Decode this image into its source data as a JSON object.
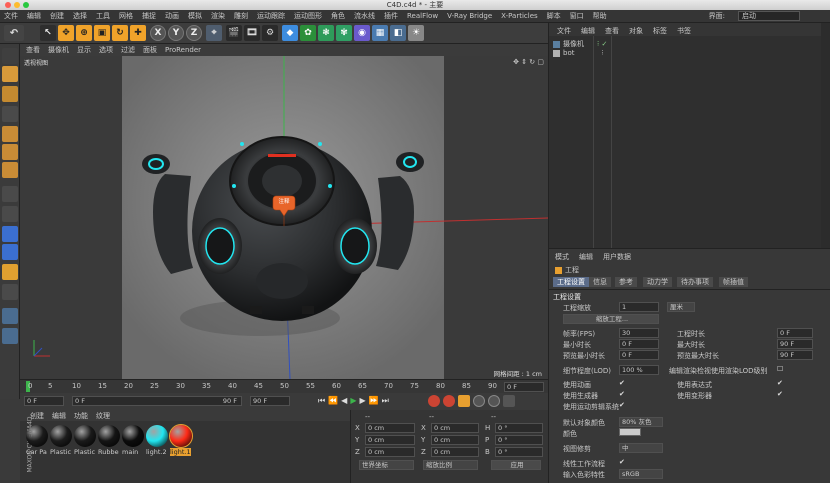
{
  "title": "C4D.c4d * - 主要",
  "menus": [
    "文件",
    "编辑",
    "创建",
    "选择",
    "工具",
    "网格",
    "捕捉",
    "动画",
    "模拟",
    "渲染",
    "雕刻",
    "运动跟踪",
    "运动图形",
    "角色",
    "流水线",
    "插件",
    "RealFlow",
    "V-Ray Bridge",
    "X-Particles",
    "脚本",
    "窗口",
    "帮助"
  ],
  "layout": {
    "label": "界面:",
    "value": "启动"
  },
  "toolbar": {
    "x": "X",
    "y": "Y",
    "z": "Z"
  },
  "viewport": {
    "menu": [
      "查看",
      "摄像机",
      "显示",
      "选项",
      "过滤",
      "面板",
      "ProRender"
    ],
    "title": "透视视图",
    "grid_label": "网格间距 : 1 cm",
    "tag_label": "注释"
  },
  "timeline": {
    "ticks": [
      "0",
      "5",
      "10",
      "15",
      "20",
      "25",
      "30",
      "35",
      "40",
      "45",
      "50",
      "55",
      "60",
      "65",
      "70",
      "75",
      "80",
      "85",
      "90"
    ],
    "current": "0 F"
  },
  "transport": {
    "start": "0 F",
    "start2": "0 F",
    "end": "90 F",
    "end2": "90 F"
  },
  "materials": {
    "menu": [
      "创建",
      "编辑",
      "功能",
      "纹理"
    ],
    "items": [
      {
        "name": "Car Pa",
        "color": "#1b1b1b"
      },
      {
        "name": "Plastic",
        "color": "#1c1c1c"
      },
      {
        "name": "Plastic",
        "color": "#1a1a1a"
      },
      {
        "name": "Rubbe",
        "color": "#151515"
      },
      {
        "name": "main",
        "color": "#0d0d0d"
      },
      {
        "name": "light.2",
        "color": "#22e6f0"
      },
      {
        "name": "light.1",
        "color": "#ff2a16"
      }
    ]
  },
  "brand": "MAXON CINEMA4D",
  "coords": {
    "header1": "--",
    "header2": "--",
    "header3": "--",
    "rows": [
      {
        "axis": "X",
        "pos": "0 cm",
        "axis2": "X",
        "rot": "0 cm",
        "axis3": "H",
        "ang": "0 °"
      },
      {
        "axis": "Y",
        "pos": "0 cm",
        "axis2": "Y",
        "rot": "0 cm",
        "axis3": "P",
        "ang": "0 °"
      },
      {
        "axis": "Z",
        "pos": "0 cm",
        "axis2": "Z",
        "rot": "0 cm",
        "axis3": "B",
        "ang": "0 °"
      }
    ],
    "mode1": "世界坐标",
    "mode2": "缩放比例",
    "apply": "应用"
  },
  "objects": {
    "menu": [
      "文件",
      "编辑",
      "查看",
      "对象",
      "标签",
      "书签"
    ],
    "items": [
      "摄像机",
      "bot"
    ]
  },
  "attributes": {
    "menu": [
      "模式",
      "编辑",
      "用户数据"
    ],
    "section": "工程",
    "tabs": [
      "工程设置",
      "信息",
      "参考",
      "动力学",
      "待办事项",
      "帧插值"
    ],
    "heading": "工程设置",
    "scale_label": "工程缩放",
    "scale_value": "1",
    "scale_unit": "厘米",
    "scale_button": "缩放工程...",
    "fps_label": "帧率(FPS)",
    "fps_value": "30",
    "proj_time_label": "工程时长",
    "proj_time_value": "0 F",
    "min_time_label": "最小时长",
    "min_time_value": "0 F",
    "max_time_label": "最大时长",
    "max_time_value": "90 F",
    "prev_min_label": "预览最小时长",
    "prev_min_value": "0 F",
    "prev_max_label": "预览最大时长",
    "prev_max_value": "90 F",
    "lod_label": "细节程度(LOD)",
    "lod_value": "100 %",
    "lod_render_label": "编辑渲染检视使用渲染LOD级别",
    "anim_label": "使用动画",
    "expr_label": "使用表达式",
    "gen_label": "使用生成器",
    "deform_label": "使用变形器",
    "motion_label": "使用运动剪辑系统",
    "default_color_label": "默认对象颜色",
    "default_color_value": "80% 灰色",
    "color_label": "颜色",
    "view_clip_label": "视图修剪",
    "view_clip_value": "中",
    "linear_label": "线性工作流程",
    "input_color_label": "输入色彩特性",
    "input_color_value": "sRGB"
  }
}
